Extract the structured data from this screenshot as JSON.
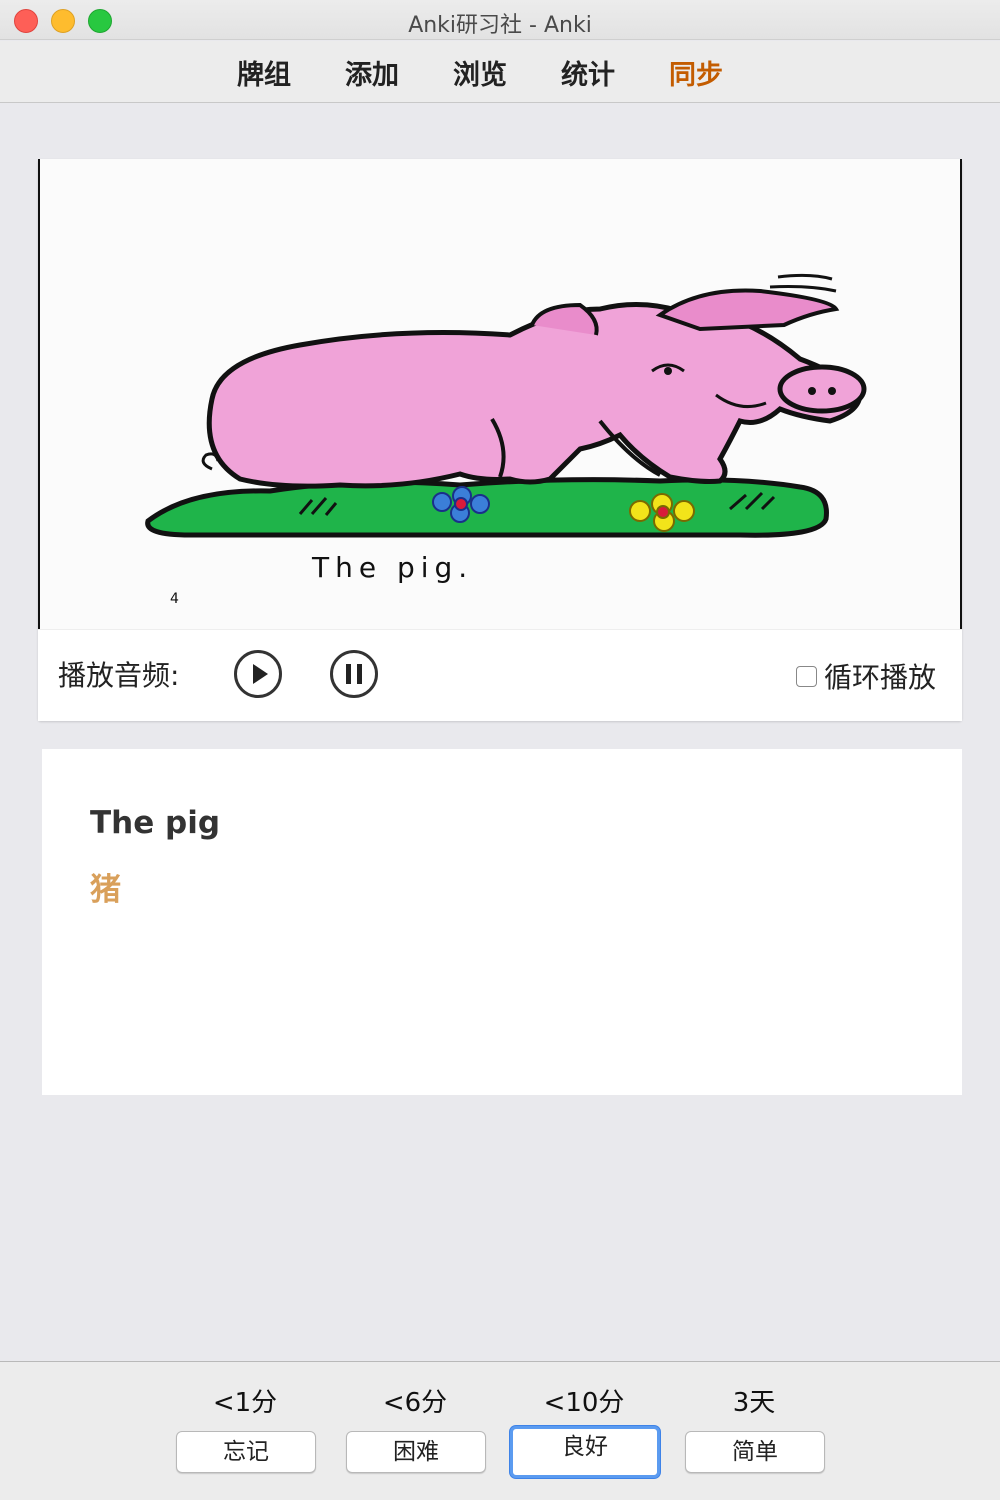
{
  "window": {
    "title": "Anki研习社 - Anki"
  },
  "menu": {
    "items": [
      {
        "label": "牌组"
      },
      {
        "label": "添加"
      },
      {
        "label": "浏览"
      },
      {
        "label": "统计"
      },
      {
        "label": "同步"
      }
    ],
    "active_color": "#c35c00"
  },
  "card": {
    "image": {
      "caption": "The pig.",
      "page_number": "4",
      "subject": "pink-pig-on-grass-illustration"
    },
    "audio": {
      "label": "播放音频:",
      "play_icon": "play-circle-icon",
      "pause_icon": "pause-circle-icon",
      "loop_label": "循环播放",
      "loop_checked": false
    },
    "word": "The pig",
    "meaning": "猪",
    "meaning_color": "#d9a05b"
  },
  "answers": [
    {
      "interval": "<1分",
      "label": "忘记"
    },
    {
      "interval": "<6分",
      "label": "困难"
    },
    {
      "interval": "<10分",
      "label": "良好",
      "focused": true
    },
    {
      "interval": "3天",
      "label": "简单"
    }
  ]
}
